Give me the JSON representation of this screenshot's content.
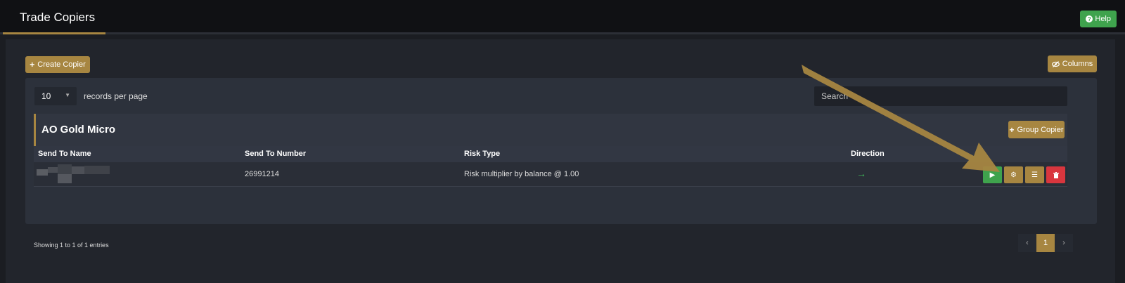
{
  "header": {
    "title": "Trade Copiers",
    "help_label": "Help"
  },
  "toolbar": {
    "create_label": "Create Copier",
    "columns_label": "Columns"
  },
  "table_controls": {
    "page_length": "10",
    "length_label": "records per page",
    "search_placeholder": "Search"
  },
  "group": {
    "name": "AO Gold Micro",
    "group_copier_label": "Group Copier"
  },
  "columns": [
    "Send To Name",
    "Send To Number",
    "Risk Type",
    "Direction"
  ],
  "rows": [
    {
      "send_to_name": "",
      "send_to_number": "26991214",
      "risk_type": "Risk multiplier by balance @ 1.00",
      "direction": "→"
    }
  ],
  "footer": {
    "info": "Showing 1 to 1 of 1 entries",
    "current_page": "1"
  },
  "colors": {
    "accent_gold": "#a78641",
    "start_green": "#3fa34d",
    "delete_red": "#d9363e",
    "annotation_arrow": "#a78641"
  },
  "icons": {
    "help": "question-circle-icon",
    "create": "plus-icon",
    "columns": "eye-slash-icon",
    "start": "play-icon",
    "settings": "cogs-icon",
    "list": "list-icon",
    "delete": "trash-icon"
  }
}
